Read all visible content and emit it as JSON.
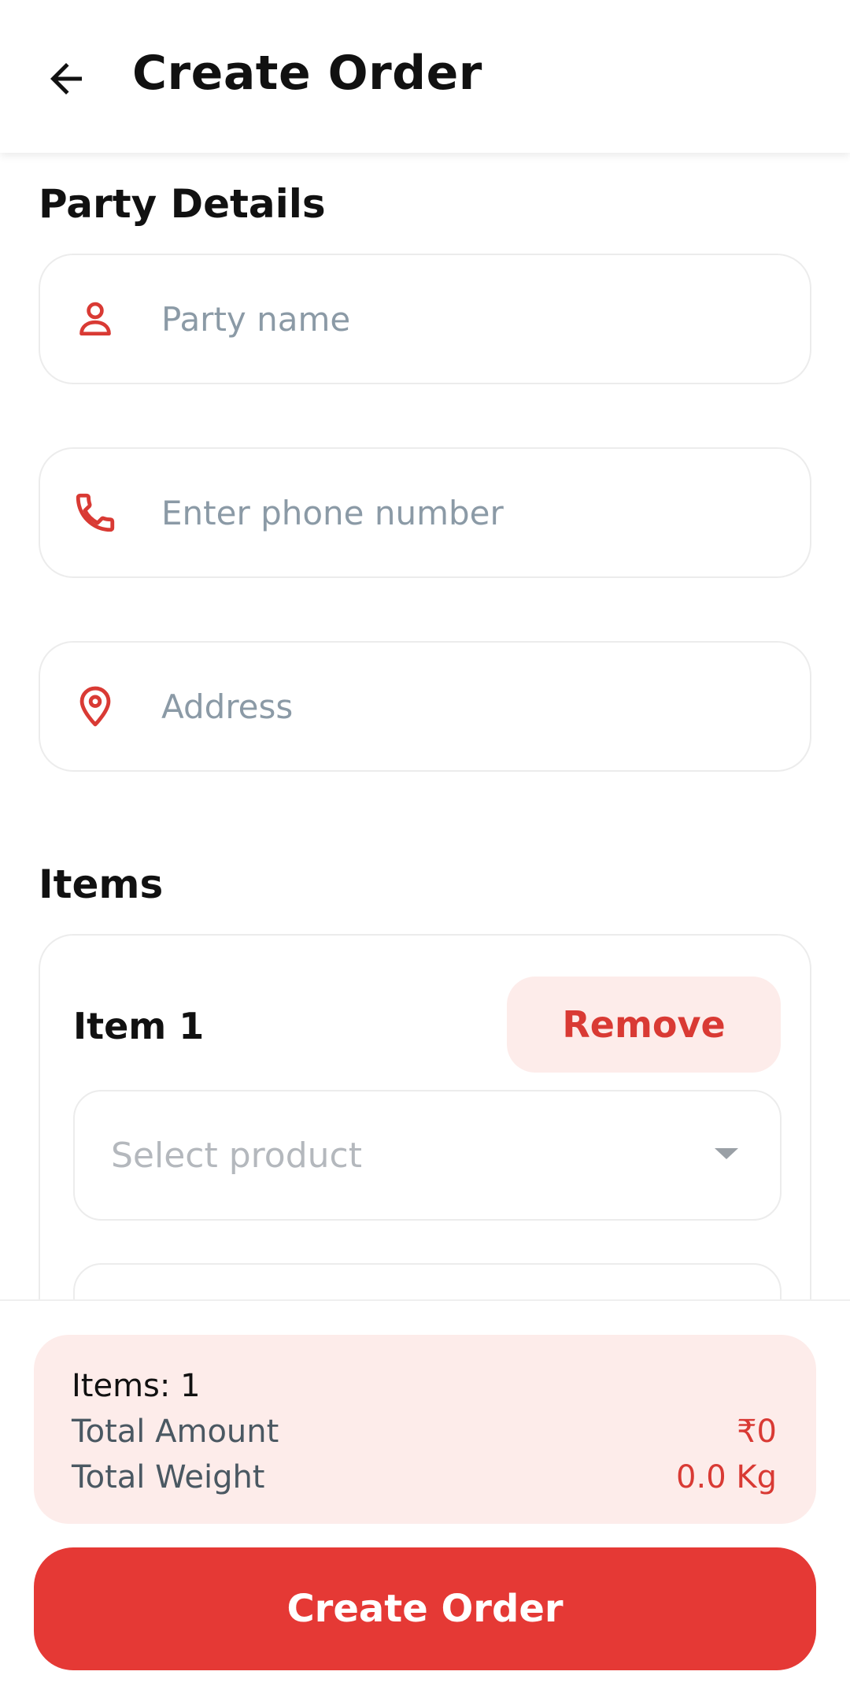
{
  "header": {
    "title": "Create Order",
    "back_icon": "arrow-left-icon"
  },
  "party_details": {
    "section_title": "Party Details",
    "fields": {
      "party_name": {
        "placeholder": "Party name",
        "icon": "person-icon"
      },
      "phone": {
        "placeholder": "Enter phone number",
        "icon": "phone-icon"
      },
      "address": {
        "placeholder": "Address",
        "icon": "location-pin-icon"
      }
    }
  },
  "items": {
    "section_title": "Items",
    "list": [
      {
        "label": "Item 1",
        "remove_label": "Remove",
        "product_placeholder": "Select product"
      }
    ]
  },
  "summary": {
    "items_count": "Items: 1",
    "total_amount_label": "Total Amount",
    "total_amount_value": "₹0",
    "total_weight_label": "Total Weight",
    "total_weight_value": "0.0 Kg"
  },
  "actions": {
    "create_label": "Create Order"
  },
  "colors": {
    "accent": "#e53935",
    "accent_text": "#d93a34",
    "accent_soft": "#fdecea",
    "placeholder": "#8b9aa6"
  }
}
